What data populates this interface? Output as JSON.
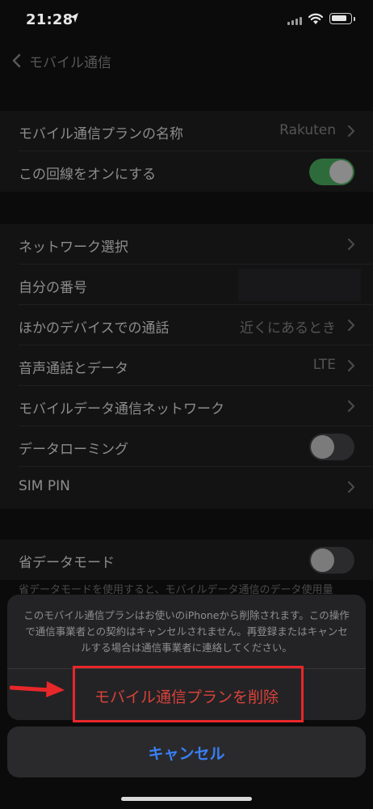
{
  "status_bar": {
    "time": "21:28"
  },
  "nav": {
    "back_label": "モバイル通信"
  },
  "group1": {
    "rows": [
      {
        "label": "モバイル通信プランの名称",
        "value": "Rakuten"
      },
      {
        "label": "この回線をオンにする",
        "toggle_on": true
      }
    ]
  },
  "group2": {
    "rows": [
      {
        "label": "ネットワーク選択"
      },
      {
        "label": "自分の番号"
      },
      {
        "label": "ほかのデバイスでの通話",
        "value": "近くにあるとき"
      },
      {
        "label": "音声通話とデータ",
        "value": "LTE"
      },
      {
        "label": "モバイルデータ通信ネットワーク"
      },
      {
        "label": "データローミング",
        "toggle_on": false
      },
      {
        "label": "SIM PIN"
      }
    ]
  },
  "group3": {
    "rows": [
      {
        "label": "省データモード",
        "toggle_on": false
      }
    ],
    "footer": "省データモードを使用すると、モバイルデータ通信のデータ使用量"
  },
  "action_sheet": {
    "message": "このモバイル通信プランはお使いのiPhoneから削除されます。この操作で通信事業者との契約はキャンセルされません。再登録またはキャンセルする場合は通信事業者に連絡してください。",
    "delete_label": "モバイル通信プランを削除",
    "cancel_label": "キャンセル"
  },
  "colors": {
    "destructive": "#d9423a",
    "cancel_blue": "#3a7ff6",
    "highlight_red": "#e8272a",
    "toggle_on_green": "#2e6b3b"
  }
}
